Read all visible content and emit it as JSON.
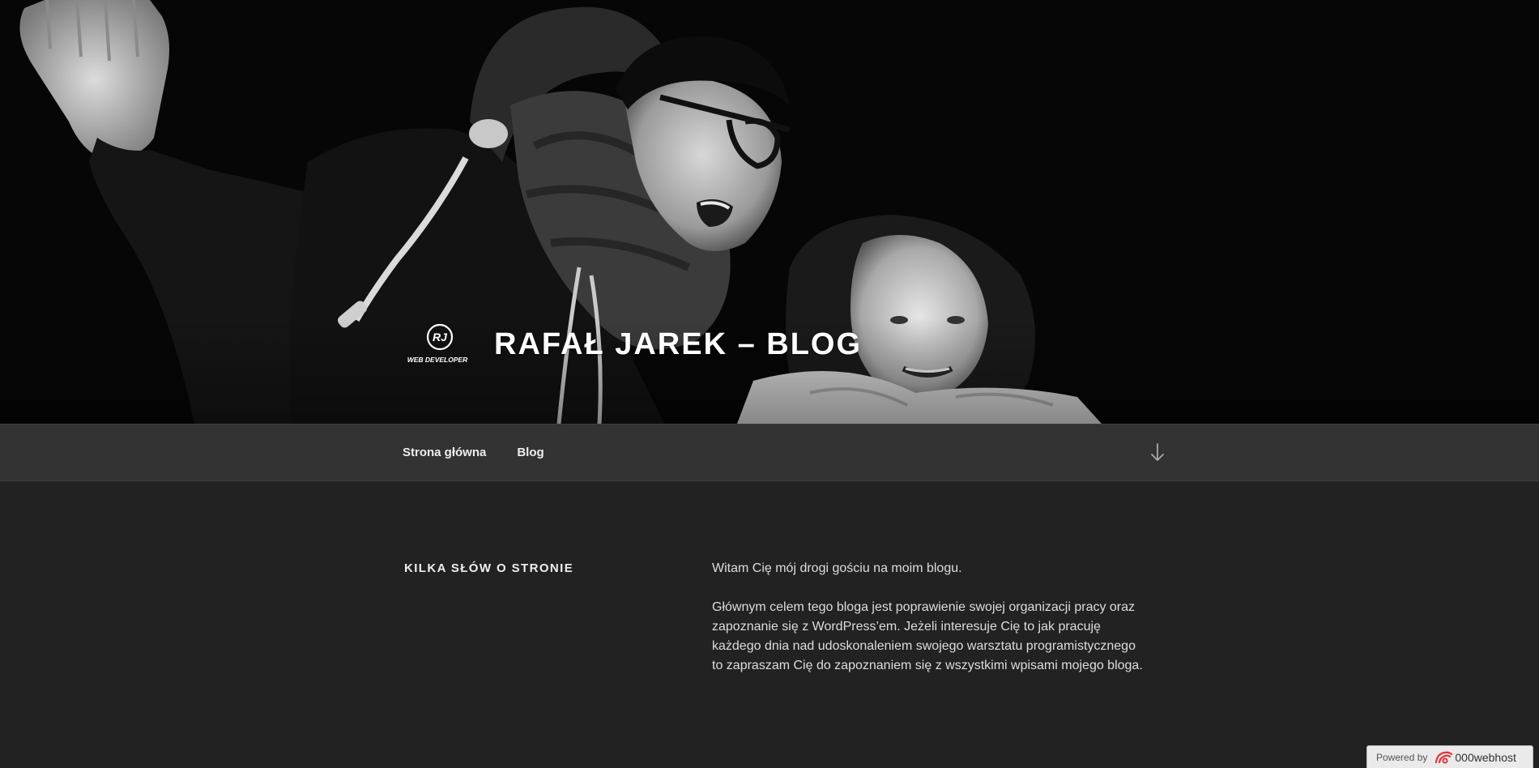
{
  "site": {
    "title": "RAFAŁ JAREK – BLOG",
    "logo_text": "WEB DEVELOPER",
    "logo_initials": "RJ"
  },
  "nav": {
    "items": [
      {
        "label": "Strona główna"
      },
      {
        "label": "Blog"
      }
    ],
    "scroll_icon": "arrow-down-icon"
  },
  "widget": {
    "title": "KILKA SŁÓW O STRONIE",
    "paragraphs": [
      "Witam Cię mój drogi gościu na moim blogu.",
      "Głównym celem tego bloga jest poprawienie swojej organizacji pracy oraz zapoznanie się z WordPress’em. Jeżeli interesuje Cię to jak pracuję każdego dnia nad udoskonaleniem swojego warsztatu programistycznego to zapraszam Cię do zapoznaniem się z wszystkimi wpisami mojego bloga."
    ]
  },
  "powered": {
    "label": "Powered by",
    "brand": "000webhost"
  },
  "colors": {
    "background": "#222222",
    "nav_background": "#333333",
    "text": "#dddddd",
    "accent_logo": "#e0353b"
  }
}
